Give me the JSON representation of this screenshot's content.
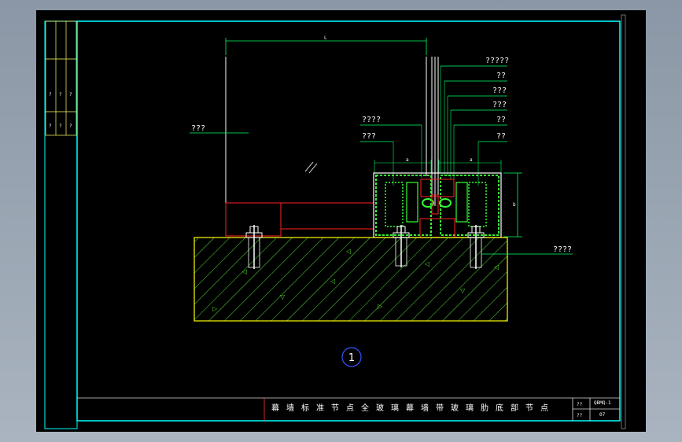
{
  "drawing": {
    "detail_number": "1",
    "dimension_width": "L",
    "dimension_height": "b",
    "dimension_small_left": "a",
    "dimension_small_right": "a",
    "callouts_right": [
      "?????",
      "??",
      "???",
      "???",
      "??",
      "??"
    ],
    "callouts_left": [
      "????",
      "???"
    ],
    "left_label": "???",
    "anchor_label": "????"
  },
  "side_panel": {
    "marks": [
      "?",
      "?",
      "?",
      "?",
      "?",
      "?"
    ]
  },
  "title_block": {
    "title": "幕墙标准节点全玻璃幕墙带玻璃肋底部节点",
    "field_label_1": "??",
    "field_label_2": "??",
    "drawing_no": "QBMQ-1",
    "sheet_no": "07"
  }
}
